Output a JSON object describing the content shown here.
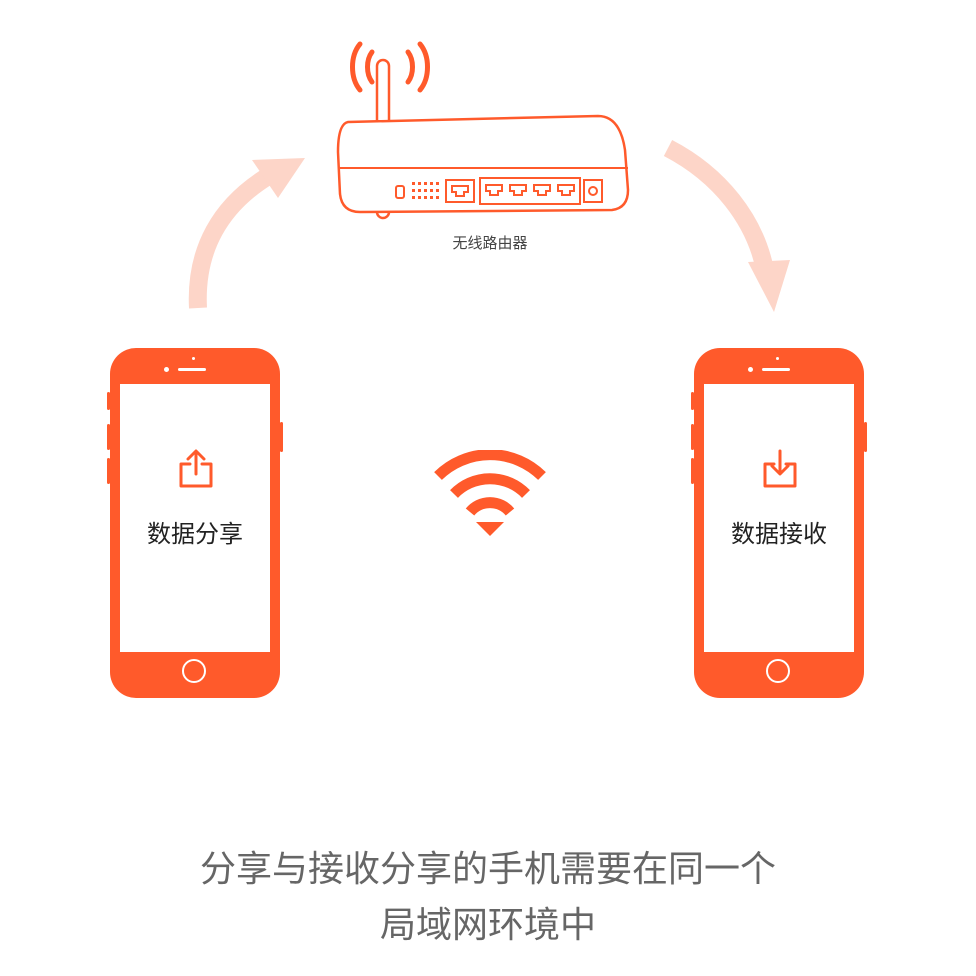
{
  "router": {
    "label": "无线路由器",
    "icon": "router-icon"
  },
  "phones": {
    "left": {
      "label": "数据分享",
      "icon": "upload-share-icon"
    },
    "right": {
      "label": "数据接收",
      "icon": "download-receive-icon"
    }
  },
  "wifi": {
    "icon": "wifi-icon"
  },
  "caption": {
    "line1": "分享与接收分享的手机需要在同一个",
    "line2": "局域网环境中"
  },
  "colors": {
    "accent": "#ff5a2b",
    "arrow": "#fdd5c8",
    "text": "#222222",
    "caption": "#666666"
  }
}
